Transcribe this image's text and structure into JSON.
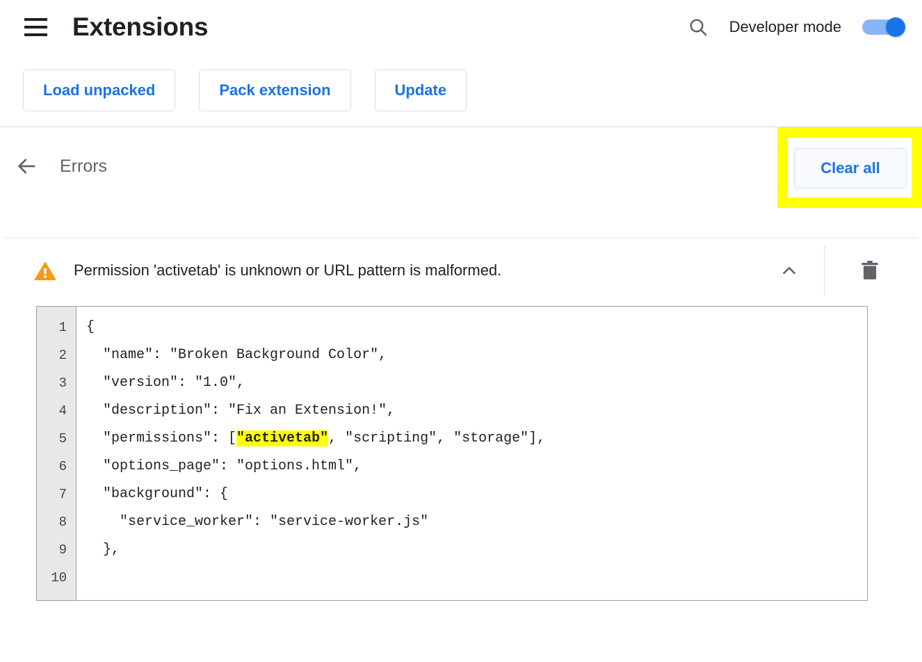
{
  "toolbar": {
    "menu_icon": "hamburger-menu-icon",
    "title": "Extensions",
    "search_icon": "search-icon",
    "developer_mode_label": "Developer mode",
    "developer_mode_on": true
  },
  "actions": {
    "load_unpacked": "Load unpacked",
    "pack_extension": "Pack extension",
    "update": "Update"
  },
  "errors_header": {
    "back_icon": "back-arrow-icon",
    "title": "Errors",
    "clear_all_label": "Clear all",
    "highlight_color": "#ffff00"
  },
  "error_item": {
    "severity_icon": "warning-triangle-icon",
    "message": "Permission 'activetab' is unknown or URL pattern is malformed.",
    "collapse_icon": "chevron-up-icon",
    "delete_icon": "trash-icon",
    "expanded": true
  },
  "code_block": {
    "line_numbers": [
      "1",
      "2",
      "3",
      "4",
      "5",
      "6",
      "7",
      "8",
      "9",
      "10"
    ],
    "lines": [
      {
        "pre": "{",
        "hl": "",
        "post": ""
      },
      {
        "pre": "  \"name\": \"Broken Background Color\",",
        "hl": "",
        "post": ""
      },
      {
        "pre": "  \"version\": \"1.0\",",
        "hl": "",
        "post": ""
      },
      {
        "pre": "  \"description\": \"Fix an Extension!\",",
        "hl": "",
        "post": ""
      },
      {
        "pre": "  \"permissions\": [",
        "hl": "\"activetab\"",
        "post": ", \"scripting\", \"storage\"],"
      },
      {
        "pre": "  \"options_page\": \"options.html\",",
        "hl": "",
        "post": ""
      },
      {
        "pre": "  \"background\": {",
        "hl": "",
        "post": ""
      },
      {
        "pre": "    \"service_worker\": \"service-worker.js\"",
        "hl": "",
        "post": ""
      },
      {
        "pre": "  },",
        "hl": "",
        "post": ""
      },
      {
        "pre": "",
        "hl": "",
        "post": ""
      }
    ]
  },
  "colors": {
    "accent_blue": "#1a73e8",
    "warning_orange": "#f29900",
    "highlight_yellow": "#ffff00",
    "text_primary": "#202124",
    "text_secondary": "#5f6368"
  }
}
